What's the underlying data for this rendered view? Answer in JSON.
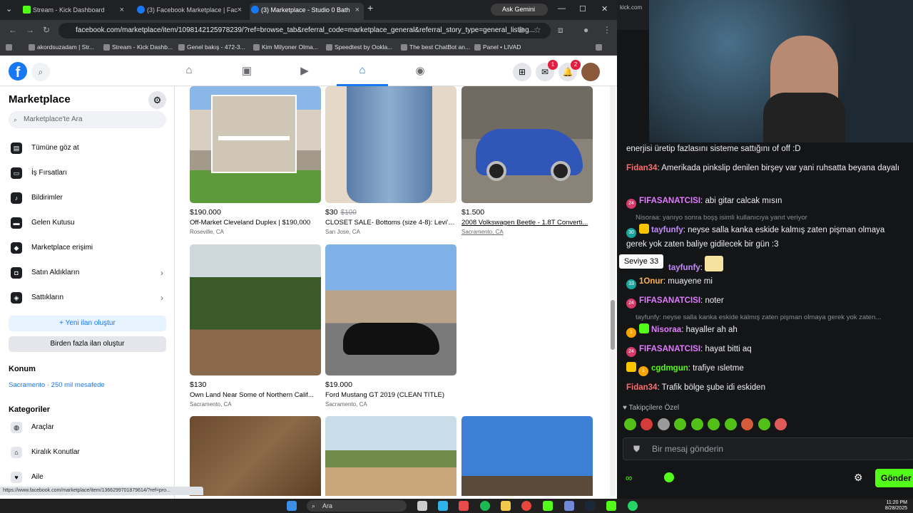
{
  "browser": {
    "tabs": [
      {
        "label": "Stream - Kick Dashboard"
      },
      {
        "label": "(3) Facebook Marketplace | Fac"
      },
      {
        "label": "(3) Marketplace - Studio 0 Bath"
      }
    ],
    "gemini": "Ask Gemini",
    "url": "facebook.com/marketplace/item/1098142125978239/?ref=browse_tab&referral_code=marketplace_general&referral_story_type=general_listing...",
    "bookmarks": [
      "akordsuzadam | Str...",
      "Stream - Kick Dashb...",
      "Genel bakış - 472-3...",
      "Kim Milyoner Olma...",
      "Speedtest by Ookla...",
      "The best ChatBot an...",
      "Panel • LIVAD"
    ],
    "status_url": "https://www.facebook.com/marketplace/item/1366299701879614/?ref=pro..."
  },
  "fb": {
    "logo": "f",
    "messenger_badge": "1",
    "notif_badge": "2"
  },
  "sidebar": {
    "title": "Marketplace",
    "search_placeholder": "Marketplace'te Ara",
    "items": [
      {
        "label": "Tümüne göz at",
        "icon": "store-icon"
      },
      {
        "label": "İş Fırsatları",
        "icon": "briefcase-icon"
      },
      {
        "label": "Bildirimler",
        "icon": "bell-icon"
      },
      {
        "label": "Gelen Kutusu",
        "icon": "inbox-icon"
      },
      {
        "label": "Marketplace erişimi",
        "icon": "shield-icon"
      },
      {
        "label": "Satın Aldıkların",
        "icon": "bag-icon"
      },
      {
        "label": "Sattıkların",
        "icon": "tag-icon"
      }
    ],
    "create_listing": "Yeni ilan oluştur",
    "create_multiple": "Birden fazla ilan oluştur",
    "location_heading": "Konum",
    "location_value": "Sacramento · 250 mil mesafede",
    "categories_heading": "Kategoriler",
    "categories": [
      "Araçlar",
      "Kiralık Konutlar",
      "Aile"
    ]
  },
  "listings": [
    {
      "price": "$190.000",
      "old_price": "",
      "title": "Off-Market Cleveland Duplex | $190,000",
      "location": "Roseville, CA"
    },
    {
      "price": "$30",
      "old_price": "$100",
      "title": "CLOSET SALE- Bottoms (size 4-8): Levi's,...",
      "location": "San Jose, CA"
    },
    {
      "price": "$1.500",
      "old_price": "",
      "title": "2008 Volkswagen Beetle - 1.8T Converti...",
      "location": "Sacramento, CA"
    },
    {
      "price": "$130",
      "old_price": "",
      "title": "Own Land Near Some of Northern Calif...",
      "location": "Sacramento, CA"
    },
    {
      "price": "$19.000",
      "old_price": "",
      "title": "Ford Mustang GT 2019 (CLEAN TITLE)",
      "location": "Sacramento, CA"
    }
  ],
  "kick": {
    "tab_label": "kick.com",
    "chat": [
      {
        "text": "enerjisi üretip fazlasını sisteme sattığını of off :D"
      },
      {
        "user": "Fidan34",
        "text": "Amerikada pinkslip denilen birşey var yani ruhsatta beyana dayalı"
      },
      {
        "user": "FIFASANATCISI",
        "text": "abi gitar calcak mısın"
      },
      {
        "reply": "Nisoraa: yanıyo sonra boşş isimli kullanıcıya yanıt veriyor"
      },
      {
        "user": "tayfunfy",
        "text": "neyse salla kanka eskide kalmış zaten pişman olmaya gerek yok zaten baliye gidilecek bir gün :3"
      },
      {
        "user": "tayfunfy",
        "text": ""
      },
      {
        "user": "1Onur",
        "text": "muayene mi"
      },
      {
        "user": "FIFASANATCISI",
        "text": "noter"
      },
      {
        "reply": "tayfunfy: neyse salla kanka eskide kalmış zaten pişman olmaya gerek yok zaten..."
      },
      {
        "user": "Nisoraa",
        "text": "hayaller ah ah"
      },
      {
        "user": "FIFASANATCISI",
        "text": "hayat bitti aq"
      },
      {
        "user": "cgdmgun",
        "text": "trafiye ısletme"
      },
      {
        "user": "Fidan34",
        "text": "Trafik bölge şube idi eskiden"
      }
    ],
    "tooltip": "Seviye 33",
    "followers_only": "Takipçilere Özel",
    "message_placeholder": "Bir mesaj gönderin",
    "send": "Gönder"
  },
  "taskbar": {
    "search": "Ara",
    "time": "11:20 PM",
    "date": "8/28/2025"
  }
}
